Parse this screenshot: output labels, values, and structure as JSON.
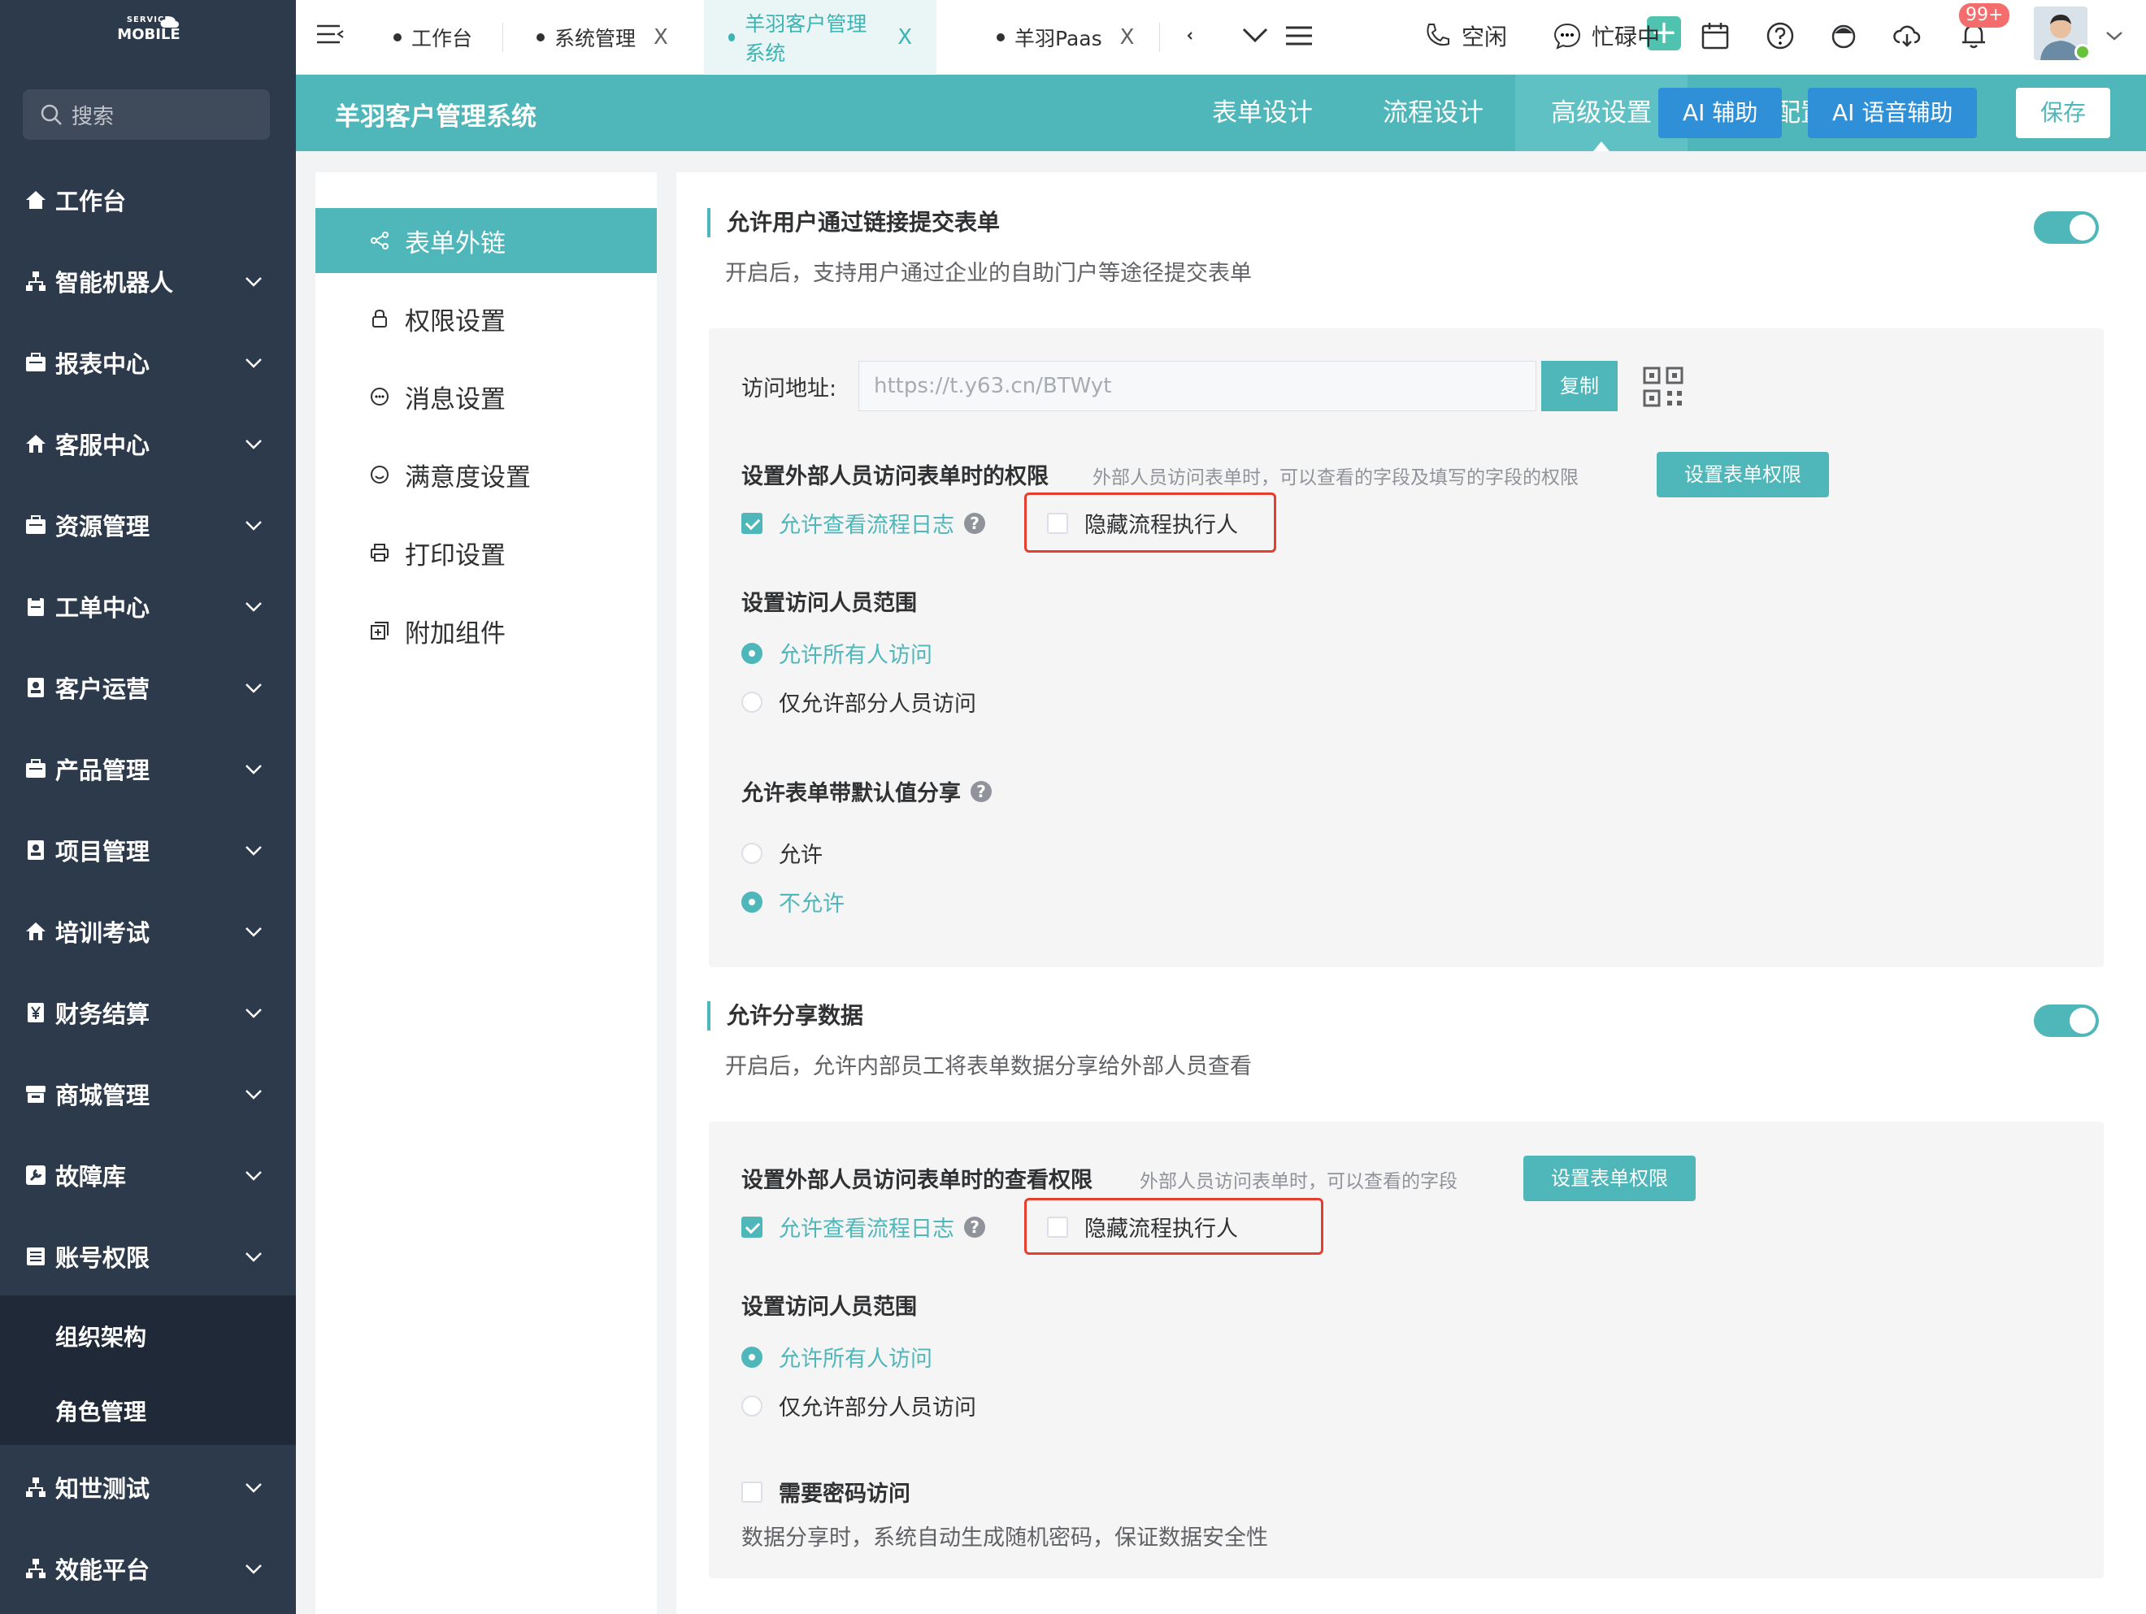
{
  "sidebar": {
    "logo": {
      "line1": "SERVICE",
      "line2": "MOBILE"
    },
    "search_label": "搜索",
    "items": [
      {
        "label": "工作台"
      },
      {
        "label": "智能机器人"
      },
      {
        "label": "报表中心"
      },
      {
        "label": "客服中心"
      },
      {
        "label": "资源管理"
      },
      {
        "label": "工单中心"
      },
      {
        "label": "客户运营"
      },
      {
        "label": "产品管理"
      },
      {
        "label": "项目管理"
      },
      {
        "label": "培训考试"
      },
      {
        "label": "财务结算"
      },
      {
        "label": "商城管理"
      },
      {
        "label": "故障库"
      },
      {
        "label": "账号权限"
      },
      {
        "label": "知世测试"
      },
      {
        "label": "效能平台"
      }
    ],
    "submenu": [
      {
        "label": "组织架构"
      },
      {
        "label": "角色管理"
      }
    ]
  },
  "topbar": {
    "tabs": [
      {
        "label": "工作台"
      },
      {
        "label": "系统管理"
      },
      {
        "label": "羊羽客户管理系统"
      },
      {
        "label": "羊羽Paas"
      }
    ],
    "close_glyph": "X",
    "status_idle": "空闲",
    "status_busy": "忙碌中",
    "badge": "99+"
  },
  "appbar": {
    "title": "羊羽客户管理系统",
    "tabs": [
      {
        "label": "表单设计"
      },
      {
        "label": "流程设计"
      },
      {
        "label": "高级设置"
      },
      {
        "label": "页面配置"
      }
    ],
    "ai_assist": "AI 辅助",
    "ai_voice": "AI 语音辅助",
    "save": "保存"
  },
  "leftpanel": {
    "items": [
      {
        "label": "表单外链"
      },
      {
        "label": "权限设置"
      },
      {
        "label": "消息设置"
      },
      {
        "label": "满意度设置"
      },
      {
        "label": "打印设置"
      },
      {
        "label": "附加组件"
      }
    ]
  },
  "section1": {
    "title": "允许用户通过链接提交表单",
    "desc": "开启后，支持用户通过企业的自助门户等途径提交表单",
    "access_label": "访问地址:",
    "url_placeholder": "https://t.y63.cn/BTWyt",
    "copy": "复制",
    "perm_title": "设置外部人员访问表单时的权限",
    "perm_hint": "外部人员访问表单时，可以查看的字段及填写的字段的权限",
    "set_perm_btn": "设置表单权限",
    "allow_log": "允许查看流程日志",
    "hide_executor": "隐藏流程执行人",
    "scope_title": "设置访问人员范围",
    "scope_all": "允许所有人访问",
    "scope_part": "仅允许部分人员访问",
    "share_default_title": "允许表单带默认值分享",
    "allow": "允许",
    "disallow": "不允许"
  },
  "section2": {
    "title": "允许分享数据",
    "desc": "开启后，允许内部员工将表单数据分享给外部人员查看",
    "perm_title": "设置外部人员访问表单时的查看权限",
    "perm_hint": "外部人员访问表单时，可以查看的字段",
    "set_perm_btn": "设置表单权限",
    "allow_log": "允许查看流程日志",
    "hide_executor": "隐藏流程执行人",
    "scope_title": "设置访问人员范围",
    "scope_all": "允许所有人访问",
    "scope_part": "仅允许部分人员访问",
    "need_pwd": "需要密码访问",
    "pwd_desc": "数据分享时，系统自动生成随机密码，保证数据安全性"
  },
  "colors": {
    "accent": "#4fb7b9",
    "sidebar": "#2d3a4b",
    "highlight": "#e53e2f"
  }
}
